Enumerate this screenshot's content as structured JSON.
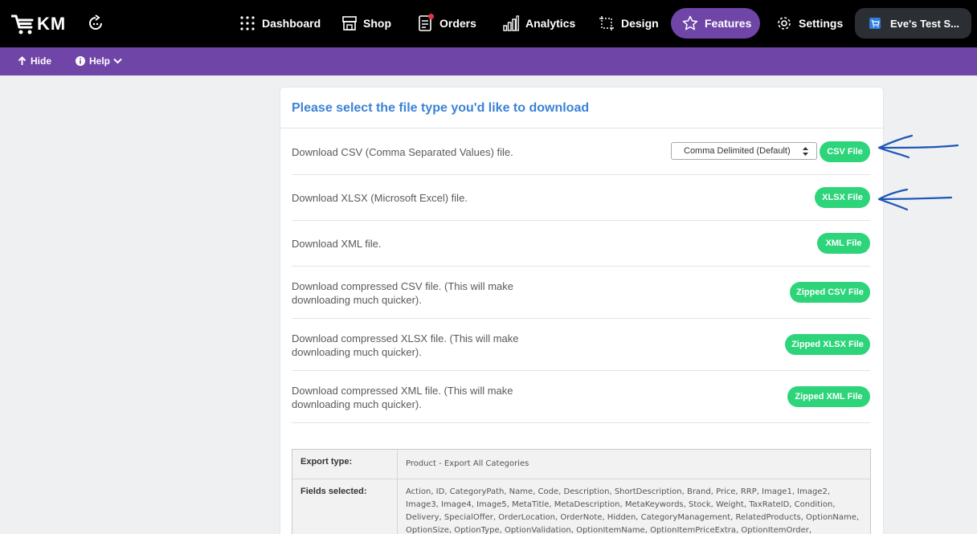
{
  "brand": {
    "logo_text": "KM"
  },
  "nav": {
    "dashboard": "Dashboard",
    "shop": "Shop",
    "orders": "Orders",
    "analytics": "Analytics",
    "design": "Design",
    "features": "Features",
    "settings": "Settings",
    "store": "Eve's Test S..."
  },
  "subnav": {
    "hide": "Hide",
    "help": "Help"
  },
  "panel": {
    "title": "Please select the file type you'd like to download",
    "rows": [
      {
        "text": "Download CSV (Comma Separated Values) file.",
        "button": "CSV File",
        "select_value": "Comma Delimited (Default)"
      },
      {
        "text": "Download XLSX (Microsoft Excel) file.",
        "button": "XLSX File"
      },
      {
        "text": "Download XML file.",
        "button": "XML File"
      },
      {
        "text": "Download compressed CSV file. (This will make downloading much quicker).",
        "button": "Zipped CSV File"
      },
      {
        "text": "Download compressed XLSX file. (This will make downloading much quicker).",
        "button": "Zipped XLSX File"
      },
      {
        "text": "Download compressed XML file. (This will make downloading much quicker).",
        "button": "Zipped XML File"
      }
    ]
  },
  "info": {
    "export_type_label": "Export type:",
    "export_type_value": "Product - Export All Categories",
    "fields_label": "Fields selected:",
    "fields_value": "Action, ID, CategoryPath, Name, Code, Description, ShortDescription, Brand, Price, RRP, Image1, Image2, Image3, Image4, Image5, MetaTitle, MetaDescription, MetaKeywords, Stock, Weight, TaxRateID, Condition, Delivery, SpecialOffer, OrderLocation, OrderNote, Hidden, CategoryManagement, RelatedProducts, OptionName, OptionSize, OptionType, OptionValidation, OptionItemName, OptionItemPriceExtra, OptionItemOrder,"
  },
  "colors": {
    "topbar": "#000000",
    "accent_purple": "#6f45a7",
    "title_blue": "#3b82d6",
    "button_green": "#2ed47a",
    "annotation_blue": "#1e56b8"
  },
  "icons": [
    "cart-logo-icon",
    "sync-icon",
    "dashboard-icon",
    "shop-icon",
    "orders-icon",
    "analytics-icon",
    "design-icon",
    "star-icon",
    "gear-icon",
    "store-cart-icon",
    "arrow-up-icon",
    "info-icon",
    "chevron-down-icon",
    "select-caret-icon"
  ]
}
